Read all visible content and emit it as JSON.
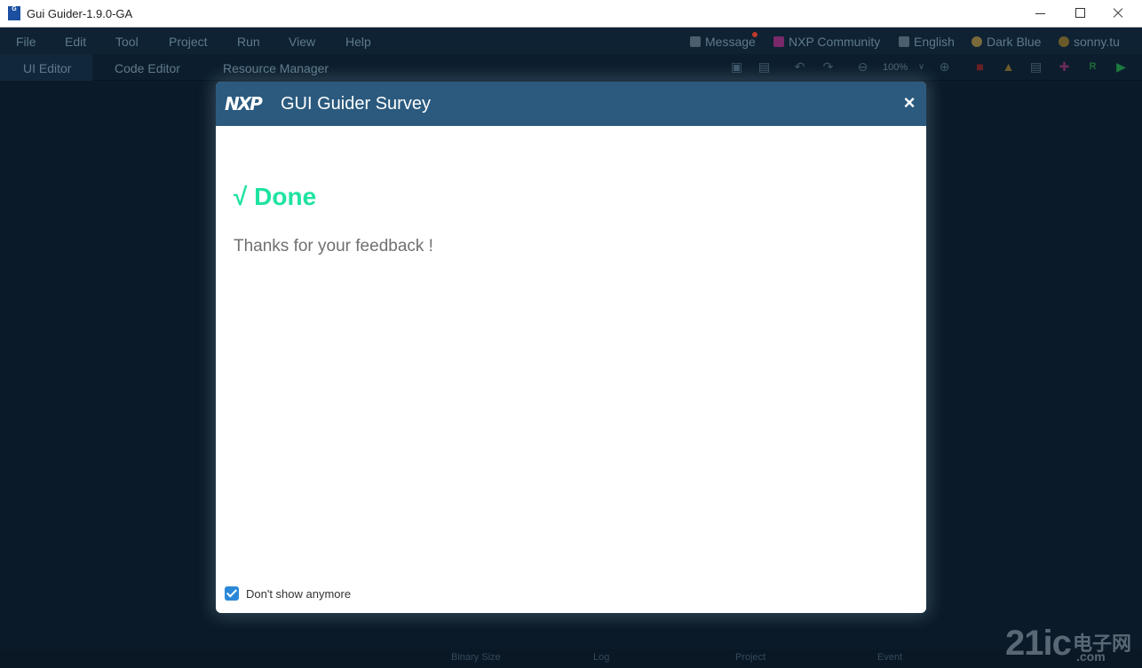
{
  "window": {
    "title": "Gui Guider-1.9.0-GA",
    "icon": "app-icon"
  },
  "menu": {
    "items": [
      "File",
      "Edit",
      "Tool",
      "Project",
      "Run",
      "View",
      "Help"
    ],
    "right": [
      {
        "label": "Message",
        "icon": "speaker-icon"
      },
      {
        "label": "NXP Community",
        "icon": "chat-icon"
      },
      {
        "label": "English",
        "icon": "language-icon"
      },
      {
        "label": "Dark Blue",
        "icon": "palette-icon"
      },
      {
        "label": "sonny.tu",
        "icon": "user-icon"
      }
    ]
  },
  "tabs": [
    {
      "label": "UI Editor",
      "active": true
    },
    {
      "label": "Code Editor",
      "active": false
    },
    {
      "label": "Resource Manager",
      "active": false
    }
  ],
  "toolbar": {
    "zoom": "100%",
    "icons": [
      "copy-icon",
      "paste-icon",
      "undo-icon",
      "redo-icon",
      "zoom-out-icon",
      "chevron-down-icon",
      "zoom-in-icon",
      "stop-icon",
      "clean-icon",
      "code-icon",
      "wrench-icon",
      "r-icon",
      "run-icon"
    ]
  },
  "statusbar": {
    "items": [
      "Binary Size",
      "Log",
      "Project",
      "Event"
    ]
  },
  "watermark": {
    "main": "21ic",
    "cn": "电子网",
    "domain": ".com"
  },
  "dialog": {
    "logo": "NXP",
    "title": "GUI Guider Survey",
    "close_glyph": "×",
    "done_label": "√ Done",
    "message": "Thanks for your feedback !",
    "checkbox_label": "Don't show anymore",
    "checkbox_checked": true
  },
  "colors": {
    "accent": "#1ee3a0",
    "header": "#2b5a7e",
    "checkbox": "#2b88d8",
    "app_bg": "#0b1a28"
  }
}
